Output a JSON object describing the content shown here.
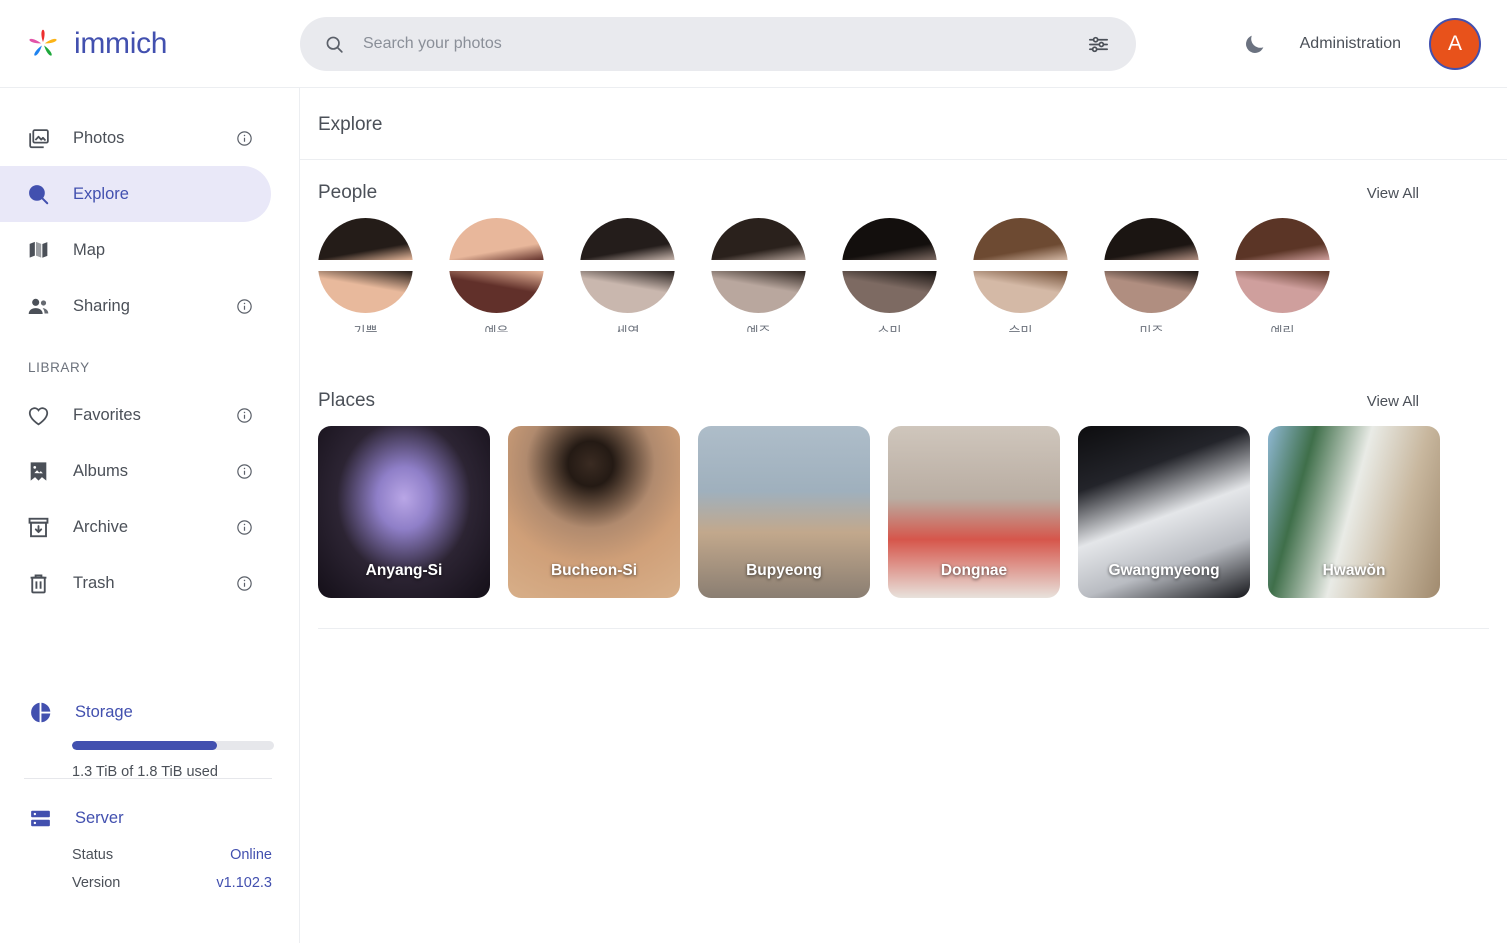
{
  "app": {
    "brand_name": "immich",
    "logo_icon": "immich-pinwheel-logo"
  },
  "search": {
    "placeholder": "Search your photos",
    "value": "",
    "search_icon": "search-icon",
    "filter_icon": "tune-filter-icon"
  },
  "header": {
    "theme_toggle_icon": "moon-icon",
    "admin_label": "Administration",
    "avatar_initial": "A",
    "avatar_bg": "#e8521b",
    "avatar_ring": "#4250af"
  },
  "sidebar": {
    "nav": [
      {
        "label": "Photos",
        "icon": "photos-icon",
        "info": true,
        "active": false
      },
      {
        "label": "Explore",
        "icon": "search-icon",
        "info": false,
        "active": true
      },
      {
        "label": "Map",
        "icon": "map-icon",
        "info": false,
        "active": false
      },
      {
        "label": "Sharing",
        "icon": "sharing-icon",
        "info": true,
        "active": false
      }
    ],
    "library_label": "LIBRARY",
    "library": [
      {
        "label": "Favorites",
        "icon": "heart-icon",
        "info": true
      },
      {
        "label": "Albums",
        "icon": "album-icon",
        "info": true
      },
      {
        "label": "Archive",
        "icon": "archive-icon",
        "info": true
      },
      {
        "label": "Trash",
        "icon": "trash-icon",
        "info": true
      }
    ],
    "storage": {
      "title": "Storage",
      "icon": "storage-pie-icon",
      "usage_text": "1.3 TiB of 1.8 TiB used",
      "percent": 72,
      "accent": "#4250af"
    },
    "server": {
      "title": "Server",
      "icon": "server-icon",
      "rows": [
        {
          "label": "Status",
          "value": "Online"
        },
        {
          "label": "Version",
          "value": "v1.102.3"
        }
      ]
    }
  },
  "main": {
    "page_title": "Explore",
    "people": {
      "title": "People",
      "view_all": "View All",
      "items": [
        {
          "name": "기쁨",
          "hair": "#241c18",
          "skin": "#e8b99c"
        },
        {
          "name": "예은",
          "hair": "#e8b79b",
          "skin": "#61302a"
        },
        {
          "name": "세영",
          "hair": "#241d1b",
          "skin": "#c9b7ae"
        },
        {
          "name": "예주",
          "hair": "#2a211c",
          "skin": "#b9a79e"
        },
        {
          "name": "소민",
          "hair": "#130f0d",
          "skin": "#7d6a62"
        },
        {
          "name": "승민",
          "hair": "#6d4a32",
          "skin": "#d4b9a6"
        },
        {
          "name": "미주",
          "hair": "#1b1512",
          "skin": "#b08e80"
        },
        {
          "name": "예린",
          "hair": "#5b3526",
          "skin": "#cf9f9d"
        }
      ]
    },
    "places": {
      "title": "Places",
      "view_all": "View All",
      "items": [
        {
          "name": "Anyang-Si",
          "tone": "theater-dark-purple"
        },
        {
          "name": "Bucheon-Si",
          "tone": "coffee-table-warm"
        },
        {
          "name": "Bupyeong",
          "tone": "street-grey-blue"
        },
        {
          "name": "Dongnae",
          "tone": "child-red-stripe"
        },
        {
          "name": "Gwangmyeong",
          "tone": "white-fabric-dark"
        },
        {
          "name": "Hwawŏn",
          "tone": "qr-sign-green"
        }
      ]
    }
  }
}
